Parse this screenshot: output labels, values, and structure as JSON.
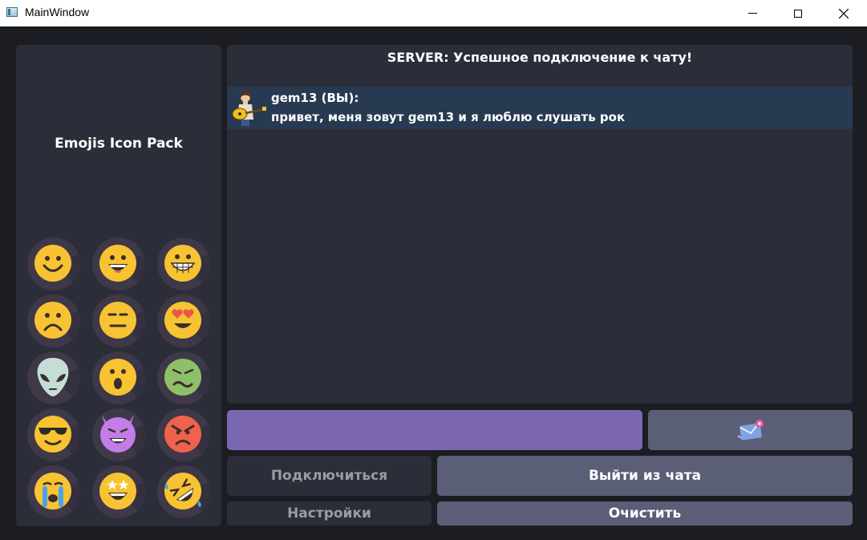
{
  "window": {
    "title": "MainWindow"
  },
  "emoji_panel": {
    "title": "Emojis Icon Pack",
    "emojis": [
      "smile-emoji-icon",
      "grin-emoji-icon",
      "grimace-emoji-icon",
      "sad-emoji-icon",
      "neutral-emoji-icon",
      "heart-eyes-emoji-icon",
      "alien-emoji-icon",
      "surprised-emoji-icon",
      "sick-emoji-icon",
      "sunglasses-emoji-icon",
      "devil-emoji-icon",
      "angry-emoji-icon",
      "crying-emoji-icon",
      "star-eyes-emoji-icon",
      "rofl-emoji-icon"
    ]
  },
  "chat": {
    "server_message": "SERVER: Успешное подключение к чату!",
    "messages": [
      {
        "author": "gem13 (ВЫ):",
        "text": "привет, меня зовут gem13 и я люблю слушать рок",
        "avatar": "guitarist-avatar-icon"
      }
    ]
  },
  "input": {
    "value": "",
    "placeholder": ""
  },
  "send_button": {
    "icon": "envelope-send-icon"
  },
  "buttons": {
    "connect": "Подключиться",
    "leave": "Выйти из чата",
    "settings": "Настройки",
    "clear": "Очистить"
  },
  "colors": {
    "background": "#1c1d22",
    "panel": "#2b2e38",
    "message_highlight": "#283a52",
    "input": "#7b66b0",
    "button_active": "#5b5e77",
    "button_disabled_text": "#9a9ba3"
  }
}
